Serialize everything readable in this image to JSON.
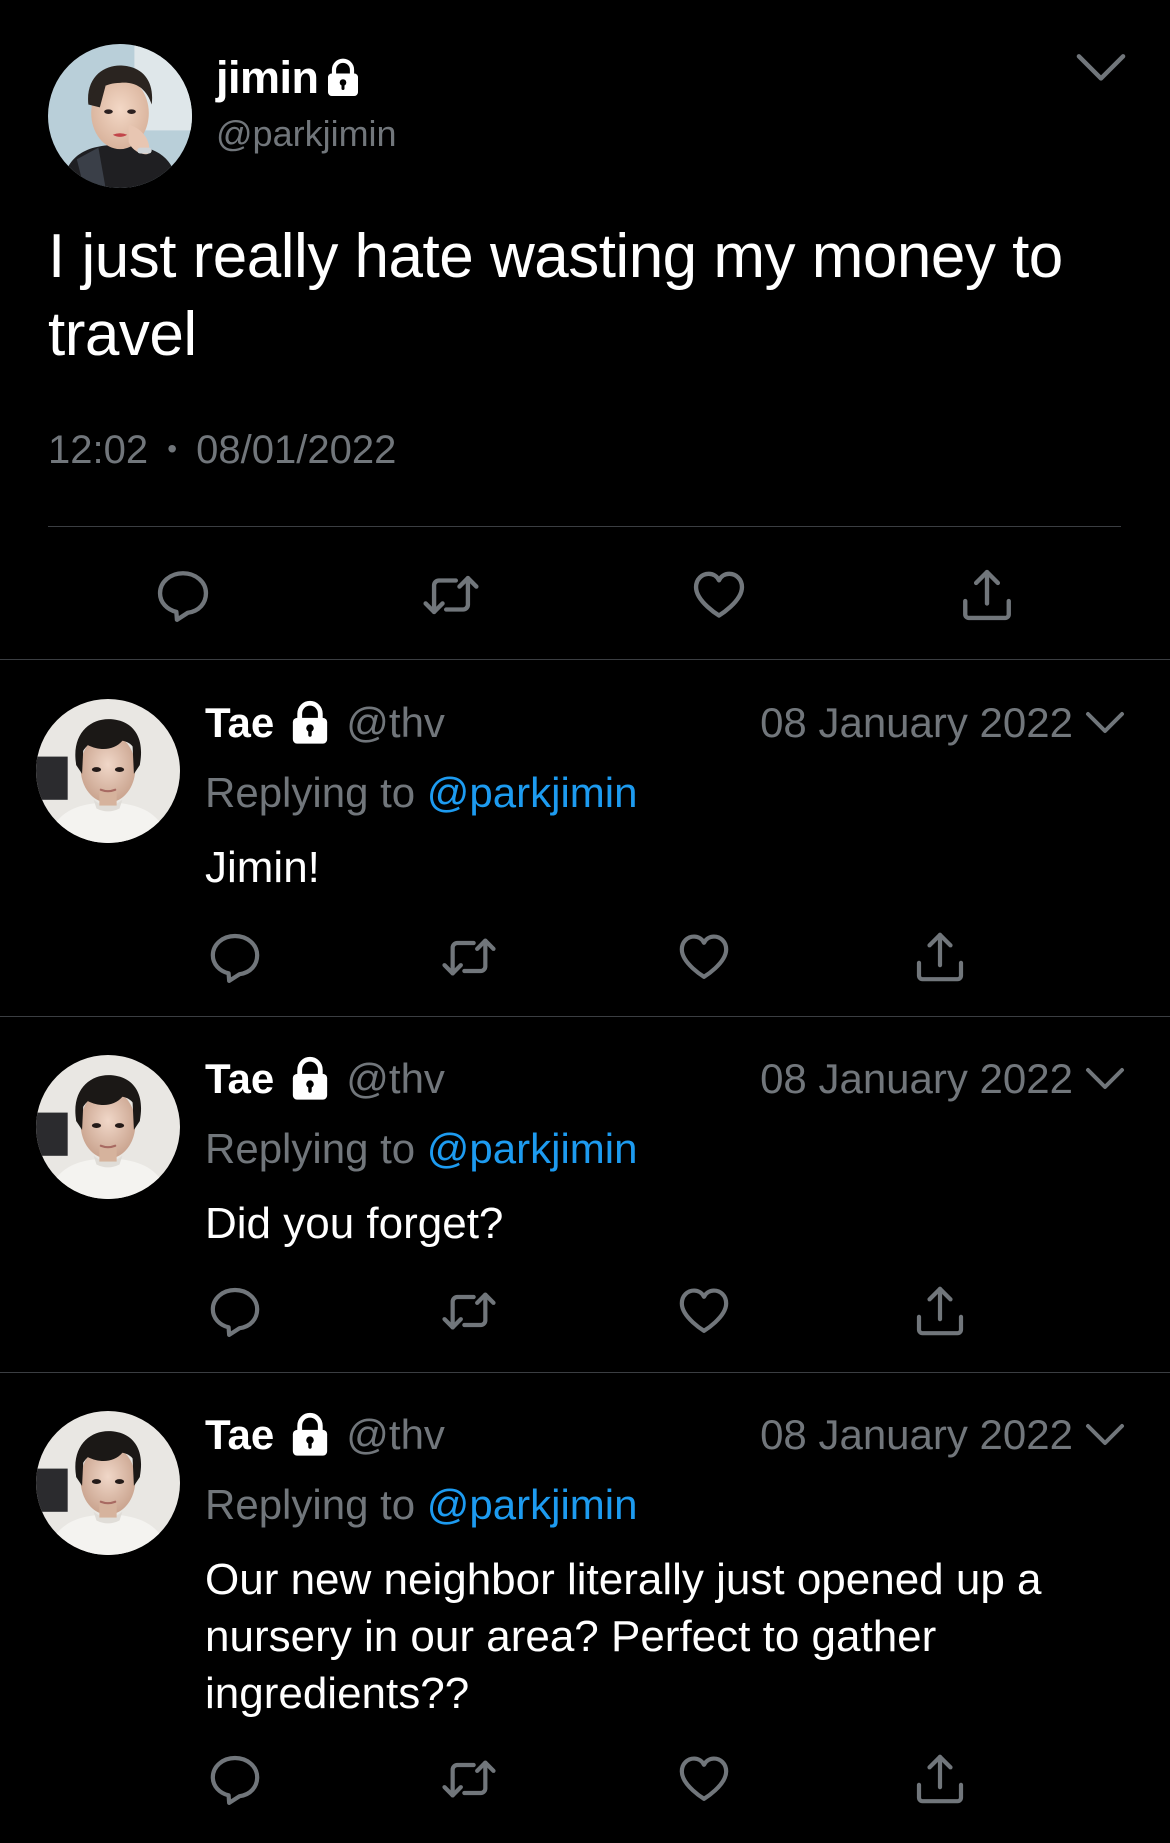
{
  "main_tweet": {
    "display_name": "jimin",
    "handle": "@parkjimin",
    "text": "I just really hate wasting my money to travel",
    "time": "12:02",
    "separator": "•",
    "date": "08/01/2022",
    "icons": {
      "lock": "lock-icon",
      "menu": "chevron-down-icon",
      "reply": "reply-icon",
      "retweet": "retweet-icon",
      "like": "heart-icon",
      "share": "share-icon"
    }
  },
  "replies": [
    {
      "display_name": "Tae",
      "handle": "@thv",
      "date": "08 January 2022",
      "replying_label": "Replying to",
      "replying_to": "@parkjimin",
      "text": "Jimin!"
    },
    {
      "display_name": "Tae",
      "handle": "@thv",
      "date": "08 January 2022",
      "replying_label": "Replying to",
      "replying_to": "@parkjimin",
      "text": "Did you forget?"
    },
    {
      "display_name": "Tae",
      "handle": "@thv",
      "date": "08 January 2022",
      "replying_label": "Replying to",
      "replying_to": "@parkjimin",
      "text": "Our new neighbor literally just opened up a nursery in our area? Perfect to gather ingredients??"
    }
  ],
  "colors": {
    "background": "#000000",
    "text_primary": "#ffffff",
    "text_secondary": "#71767b",
    "link": "#1d9bf0",
    "divider": "#3b3e42"
  }
}
